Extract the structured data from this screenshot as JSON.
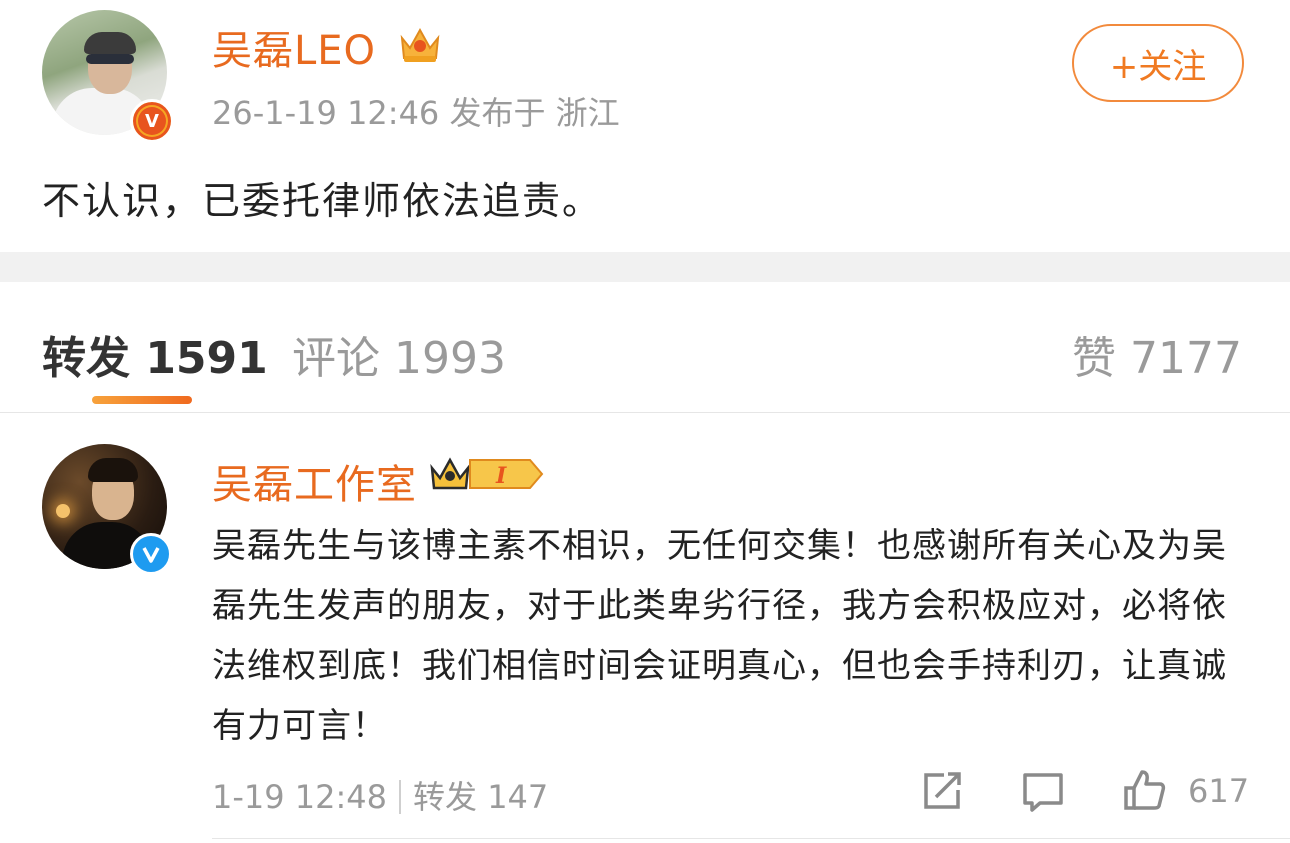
{
  "post": {
    "username": "吴磊LEO",
    "meta": "26-1-19 12:46  发布于 浙江",
    "follow_label": "+关注",
    "body": "不认识，已委托律师依法追责。"
  },
  "tabs": {
    "repost": "转发 1591",
    "comment": "评论 1993",
    "like": "赞 7177"
  },
  "repost_item": {
    "username": "吴磊工作室",
    "body": "吴磊先生与该博主素不相识，无任何交集！也感谢所有关心及为吴磊先生发声的朋友，对于此类卑劣行径，我方会积极应对，必将依法维权到底！我们相信时间会证明真心，但也会手持利刃，让真诚有力可言！",
    "time": "1-19 12:48",
    "repost_label": "转发 147",
    "like_count": "617"
  },
  "icons": {
    "verified_main": "orange-v-verified-icon",
    "verified_studio": "blue-v-verified-icon",
    "crown": "crown-icon",
    "level": "level-badge-icon",
    "share": "share-icon",
    "comment": "comment-icon",
    "like": "thumbs-up-icon"
  },
  "colors": {
    "accent": "#e86a1f",
    "muted": "#9a9a9a",
    "verified_blue": "#1e9bf0"
  }
}
